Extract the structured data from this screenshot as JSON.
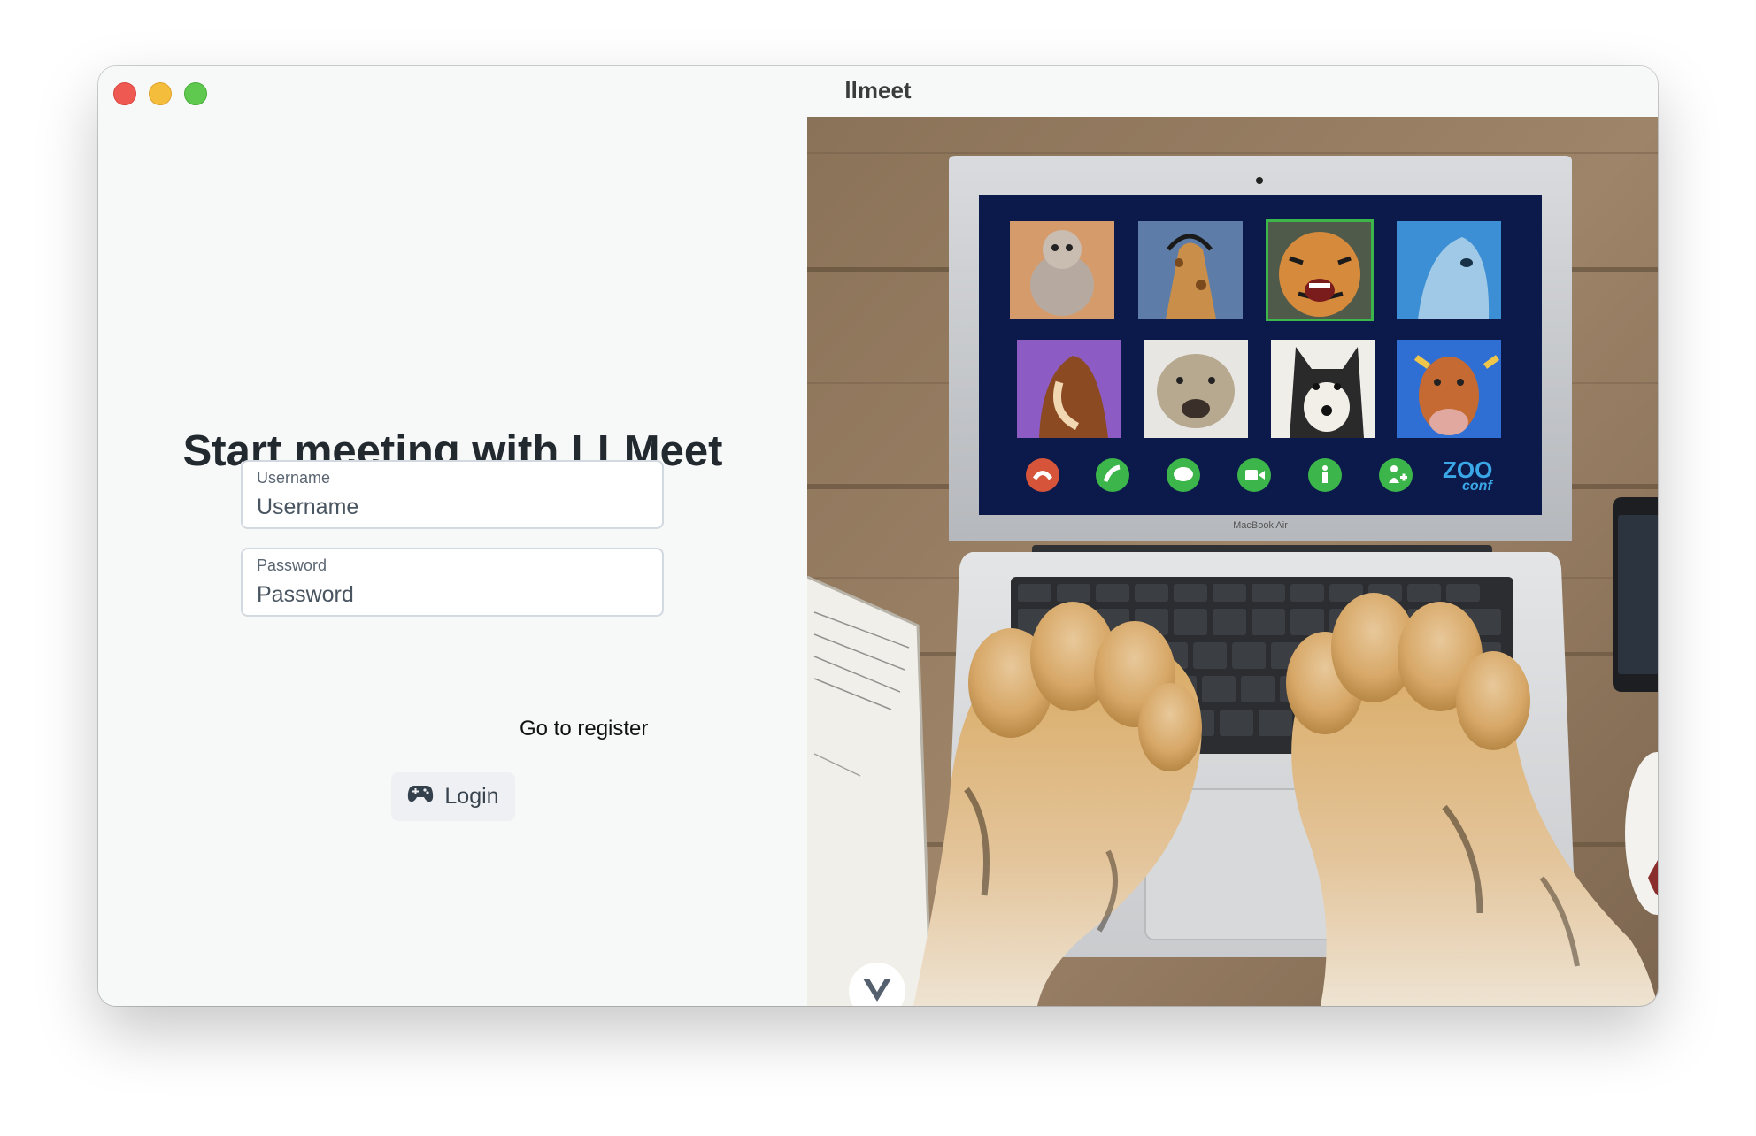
{
  "window": {
    "title": "llmeet"
  },
  "login": {
    "heading": "Start meeting with LLMeet",
    "username": {
      "label": "Username",
      "placeholder": "Username",
      "value": ""
    },
    "password": {
      "label": "Password",
      "placeholder": "Password",
      "value": ""
    },
    "register_link": "Go to register",
    "login_button": "Login"
  },
  "hero_image": {
    "screen_tiles": [
      "cat",
      "giraffe",
      "tiger",
      "dolphin",
      "horse",
      "sheep",
      "husky",
      "cow"
    ],
    "call_buttons": [
      "hang-up",
      "phone",
      "chat",
      "video",
      "info",
      "add-user"
    ],
    "brand_top": "ZOO",
    "brand_bottom": "conf",
    "laptop_label": "MacBook Air"
  },
  "colors": {
    "traffic_red": "#ee5a52",
    "traffic_yellow": "#f5bd3c",
    "traffic_green": "#5ec84f",
    "hangup_red": "#d6553a",
    "call_green": "#3cb54a",
    "screen_navy": "#0c1a4b",
    "brand_blue": "#3aa7e6"
  },
  "fab_icon": "vue-logo-icon"
}
